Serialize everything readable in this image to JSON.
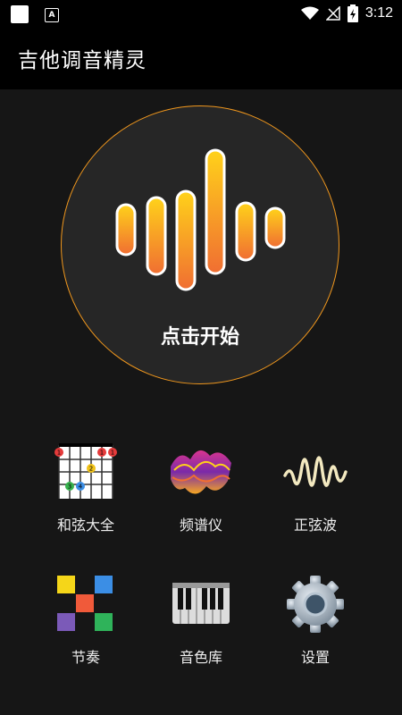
{
  "status": {
    "time": "3:12"
  },
  "app": {
    "title": "吉他调音精灵"
  },
  "start": {
    "label": "点击开始"
  },
  "grid": {
    "chords": "和弦大全",
    "spectrum": "频谱仪",
    "sine": "正弦波",
    "rhythm": "节奏",
    "sounds": "音色库",
    "settings": "设置"
  },
  "chord_icon": {
    "dots": [
      "1",
      "2",
      "3",
      "4",
      "1",
      "1"
    ]
  },
  "colors": {
    "accent": "#f0971d",
    "wave_top": "#ffd21a",
    "wave_bottom": "#f06e32"
  },
  "icons": [
    "wifi-icon",
    "signal-icon",
    "battery-icon",
    "gear-icon",
    "piano-icon",
    "sine-wave-icon"
  ]
}
